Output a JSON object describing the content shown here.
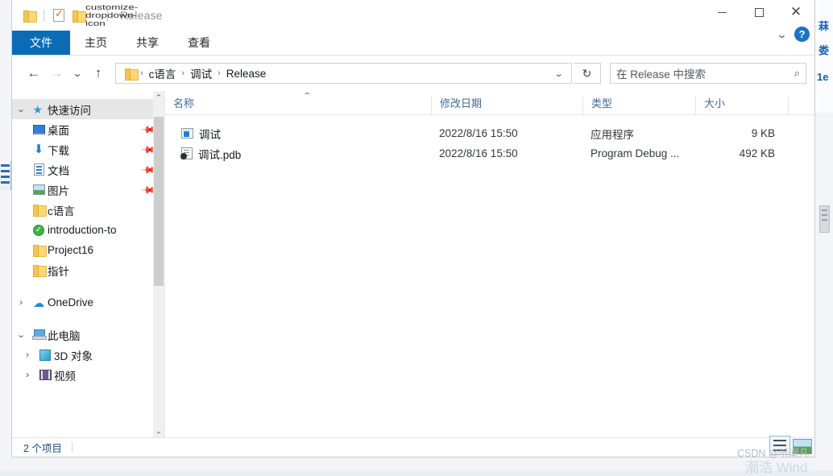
{
  "window": {
    "title": "Release",
    "quick_access_toolbar": [
      "folder-icon",
      "properties-icon",
      "new-folder-icon",
      "customize-dropdown-icon"
    ],
    "controls": {
      "minimize": "—",
      "maximize": "□",
      "close": "✕"
    },
    "ribbon_collapse": "⌄",
    "help": "?"
  },
  "ribbon": {
    "tabs": [
      {
        "label": "文件",
        "active": true
      },
      {
        "label": "主页",
        "active": false
      },
      {
        "label": "共享",
        "active": false
      },
      {
        "label": "查看",
        "active": false
      }
    ]
  },
  "address": {
    "back": "←",
    "forward": "→",
    "recent": "⌄",
    "up": "↑",
    "crumbs": [
      "c语言",
      "调试",
      "Release"
    ],
    "separator": "›",
    "dropdown": "⌄",
    "refresh": "↻"
  },
  "search": {
    "placeholder": "在 Release 中搜索",
    "icon": "⌕"
  },
  "sidebar": {
    "items": [
      {
        "label": "快速访问",
        "icon": "star-pin-icon",
        "expander": "⌄",
        "indent": 0,
        "selected": true,
        "pinned": false
      },
      {
        "label": "桌面",
        "icon": "desktop-icon",
        "expander": "",
        "indent": 1,
        "selected": false,
        "pinned": true
      },
      {
        "label": "下载",
        "icon": "download-icon",
        "expander": "",
        "indent": 1,
        "selected": false,
        "pinned": true
      },
      {
        "label": "文档",
        "icon": "documents-icon",
        "expander": "",
        "indent": 1,
        "selected": false,
        "pinned": true
      },
      {
        "label": "图片",
        "icon": "pictures-icon",
        "expander": "",
        "indent": 1,
        "selected": false,
        "pinned": true
      },
      {
        "label": "c语言",
        "icon": "folder-icon",
        "expander": "",
        "indent": 1,
        "selected": false,
        "pinned": false
      },
      {
        "label": "introduction-to",
        "icon": "sync-ok-icon",
        "expander": "",
        "indent": 1,
        "selected": false,
        "pinned": false
      },
      {
        "label": "Project16",
        "icon": "folder-icon",
        "expander": "",
        "indent": 1,
        "selected": false,
        "pinned": false
      },
      {
        "label": "指针",
        "icon": "folder-icon",
        "expander": "",
        "indent": 1,
        "selected": false,
        "pinned": false
      },
      {
        "label": "OneDrive",
        "icon": "cloud-icon",
        "expander": "›",
        "indent": 0,
        "selected": false,
        "pinned": false
      },
      {
        "label": "此电脑",
        "icon": "this-pc-icon",
        "expander": "⌄",
        "indent": 0,
        "selected": false,
        "pinned": false
      },
      {
        "label": "3D 对象",
        "icon": "3d-objects-icon",
        "expander": "›",
        "indent": 1,
        "selected": false,
        "pinned": false
      },
      {
        "label": "视频",
        "icon": "videos-icon",
        "expander": "›",
        "indent": 1,
        "selected": false,
        "pinned": false
      }
    ]
  },
  "filelist": {
    "columns": [
      "名称",
      "修改日期",
      "类型",
      "大小"
    ],
    "sort_indicator": "⌃",
    "rows": [
      {
        "name": "调试",
        "icon": "application-icon",
        "date": "2022/8/16 15:50",
        "type": "应用程序",
        "size": "9 KB"
      },
      {
        "name": "调试.pdb",
        "icon": "pdb-file-icon",
        "date": "2022/8/16 15:50",
        "type": "Program Debug ...",
        "size": "492 KB"
      }
    ]
  },
  "statusbar": {
    "item_count": "2 个项目"
  },
  "background": {
    "right_fragments": [
      "菻",
      "娄",
      "1e"
    ],
    "watermark": "CSDN @听潮凡",
    "bottom_text": "潮浩 Wind"
  },
  "colors": {
    "accent": "#0b6cb5",
    "column_header_text": "#3f6b99",
    "status_text": "#1b4f86",
    "selection": "#e6e6e6"
  }
}
